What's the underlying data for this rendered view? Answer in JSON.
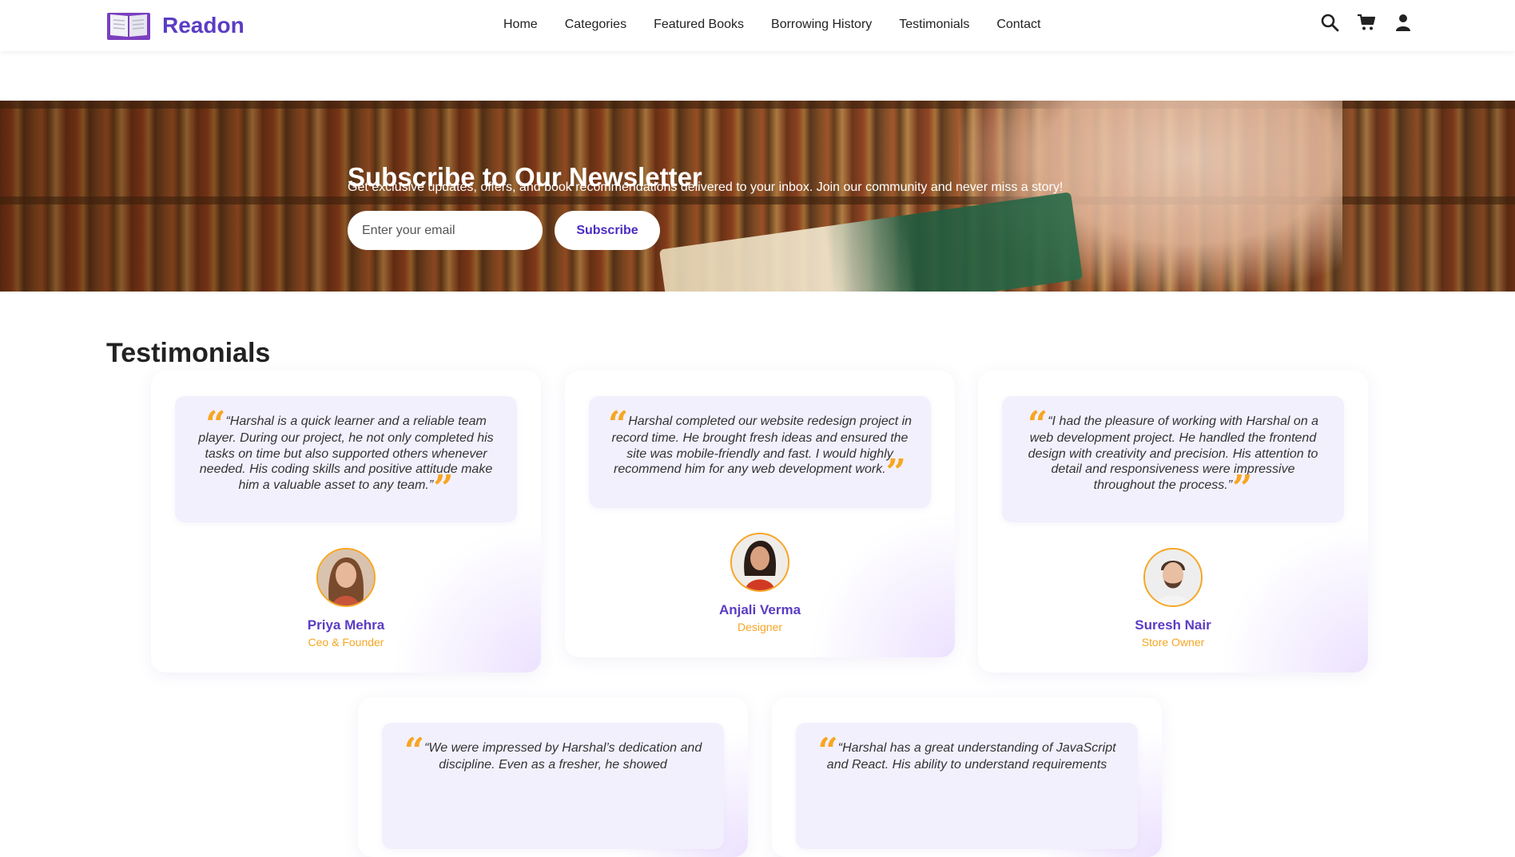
{
  "header": {
    "logo_text": "Readon",
    "nav": [
      "Home",
      "Categories",
      "Featured Books",
      "Borrowing History",
      "Testimonials",
      "Contact"
    ],
    "icons": [
      "search-icon",
      "cart-icon",
      "user-icon"
    ]
  },
  "newsletter": {
    "title": "Subscribe to Our Newsletter",
    "description": "Get exclusive updates, offers, and book recommendations delivered to your inbox. Join our community and never miss a story!",
    "email_placeholder": "Enter your email",
    "button_label": "Subscribe"
  },
  "testimonials": {
    "heading": "Testimonials",
    "items": [
      {
        "quote": "“Harshal is a quick learner and a reliable team player. During our project, he not only completed his tasks on time but also supported others whenever needed. His coding skills and positive attitude make him a valuable asset to any team.”",
        "name": "Priya Mehra",
        "role": "Ceo & Founder"
      },
      {
        "quote": "Harshal completed our website redesign project in record time. He brought fresh ideas and ensured the site was mobile-friendly and fast. I would highly recommend him for any web development work.",
        "name": "Anjali Verma",
        "role": "Designer"
      },
      {
        "quote": "“I had the pleasure of working with Harshal on a web development project. He handled the frontend design with creativity and precision. His attention to detail and responsiveness were impressive throughout the process.”",
        "name": "Suresh Nair",
        "role": "Store Owner"
      },
      {
        "quote": "“We were impressed by Harshal’s dedication and discipline. Even as a fresher, he showed",
        "name": "",
        "role": ""
      },
      {
        "quote": "“Harshal has a great understanding of JavaScript and React. His ability to understand requirements",
        "name": "",
        "role": ""
      }
    ]
  },
  "colors": {
    "brand": "#5b3cc4",
    "accent": "#f6a623",
    "quote_bg": "#f3f0fd"
  }
}
